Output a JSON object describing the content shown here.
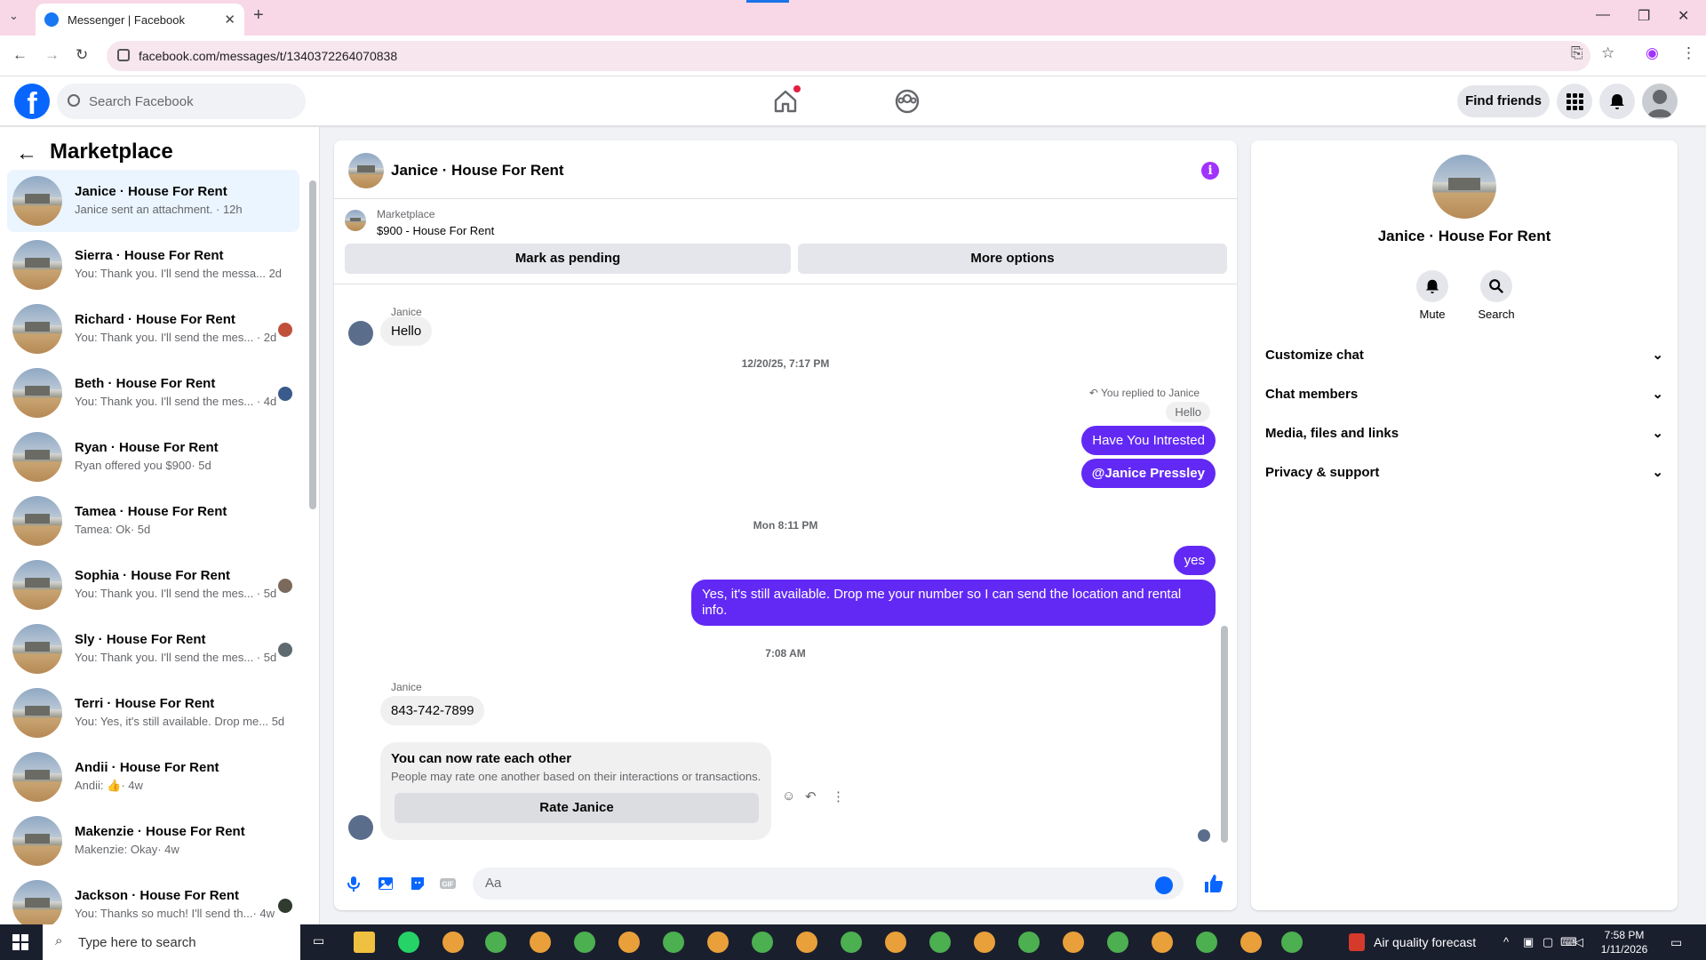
{
  "browser": {
    "tab_title": "Messenger | Facebook",
    "url": "facebook.com/messages/t/1340372264070838"
  },
  "header": {
    "search_placeholder": "Search Facebook",
    "find_friends": "Find friends"
  },
  "sidebar": {
    "title": "Marketplace",
    "conversations": [
      {
        "name": "Janice · House For Rent",
        "preview": "Janice sent an attachment.",
        "time": "· 12h"
      },
      {
        "name": "Sierra · House For Rent",
        "preview": "You: Thank you. I'll send the messa...",
        "time": "2d"
      },
      {
        "name": "Richard · House For Rent",
        "preview": "You: Thank you. I'll send the mes...",
        "time": "· 2d"
      },
      {
        "name": "Beth · House For Rent",
        "preview": "You: Thank you. I'll send the mes...",
        "time": "· 4d"
      },
      {
        "name": "Ryan · House For Rent",
        "preview": "Ryan offered you $900",
        "time": "· 5d"
      },
      {
        "name": "Tamea · House For Rent",
        "preview": "Tamea: Ok",
        "time": "· 5d"
      },
      {
        "name": "Sophia · House For Rent",
        "preview": "You: Thank you. I'll send the mes...",
        "time": "· 5d"
      },
      {
        "name": "Sly · House For Rent",
        "preview": "You: Thank you. I'll send the mes...",
        "time": "· 5d"
      },
      {
        "name": "Terri · House For Rent",
        "preview": "You: Yes, it's still available. Drop me...",
        "time": "5d"
      },
      {
        "name": "Andii · House For Rent",
        "preview": "Andii: 👍",
        "time": "· 4w"
      },
      {
        "name": "Makenzie · House For Rent",
        "preview": "Makenzie: Okay",
        "time": "· 4w"
      },
      {
        "name": "Jackson · House For Rent",
        "preview": "You: Thanks so much! I'll send th...",
        "time": "· 4w"
      }
    ]
  },
  "chat": {
    "title": "Janice · House For Rent",
    "listing_label": "Marketplace",
    "listing_title": "$900 - House For Rent",
    "mark_pending": "Mark as pending",
    "more_options": "More options",
    "sender_name": "Janice",
    "msg_hello": "Hello",
    "stamp1": "12/20/25, 7:17 PM",
    "replied_note": "You replied to Janice",
    "quoted": "Hello",
    "msg_interested": "Have You Intrested",
    "msg_mention": "@Janice Pressley",
    "stamp2": "Mon 8:11 PM",
    "msg_yes": "yes",
    "msg_available_1": "Yes, it's still available. Drop me your number so I can send the location and rental",
    "msg_available_2": "info.",
    "stamp3": "7:08 AM",
    "msg_phone": "843-742-7899",
    "rate_title": "You can now rate each other",
    "rate_sub": "People may rate one another based on their interactions or transactions.",
    "rate_button": "Rate Janice",
    "composer_placeholder": "Aa"
  },
  "details": {
    "name": "Janice · House For Rent",
    "mute": "Mute",
    "search": "Search",
    "sections": [
      "Customize chat",
      "Chat members",
      "Media, files and links",
      "Privacy & support"
    ]
  },
  "taskbar": {
    "search_placeholder": "Type here to search",
    "weather": "Air quality forecast",
    "time": "7:58 PM",
    "date": "1/11/2026"
  },
  "colors": {
    "fb_blue": "#0866ff",
    "outgoing_bubble": "#6229f5",
    "info_purple": "#a033ff"
  }
}
